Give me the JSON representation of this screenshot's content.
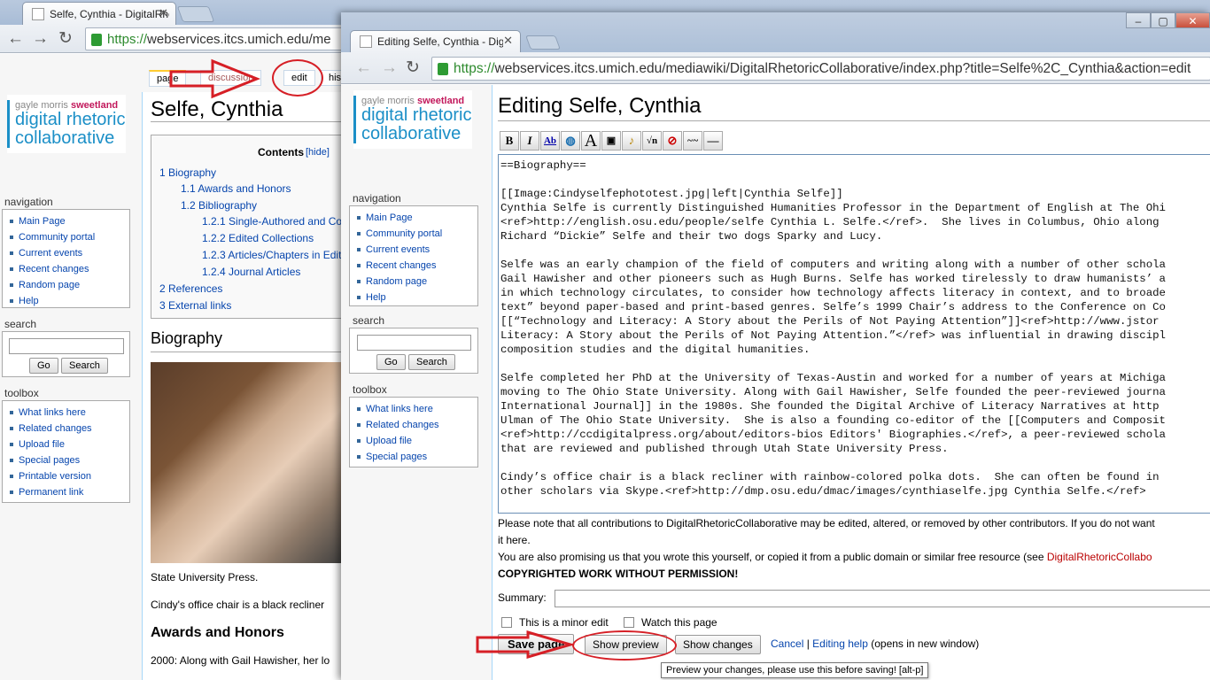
{
  "back": {
    "tab_title": "Selfe, Cynthia - DigitalRhe",
    "url_https": "https://",
    "url_rest": "webservices.itcs.umich.edu/me",
    "tabs": {
      "page": "page",
      "discussion": "discussion",
      "edit": "edit",
      "history": "his"
    },
    "page_title": "Selfe, Cynthia",
    "toc": {
      "title": "Contents",
      "hide": "[hide]",
      "items": [
        "1 Biography",
        "1.1 Awards and Honors",
        "1.2 Bibliography",
        "1.2.1 Single-Authored and Co",
        "1.2.2 Edited Collections",
        "1.2.3 Articles/Chapters in Edit",
        "1.2.4 Journal Articles",
        "2 References",
        "3 External links"
      ]
    },
    "biography_heading": "Biography",
    "para1": "State University Press.",
    "para2": "Cindy's office chair is a black recliner",
    "awards_heading": "Awards and Honors",
    "para3": "2000: Along with Gail Hawisher, her lo",
    "navigation": [
      "Main Page",
      "Community portal",
      "Current events",
      "Recent changes",
      "Random page",
      "Help"
    ],
    "toolbox": [
      "What links here",
      "Related changes",
      "Upload file",
      "Special pages",
      "Printable version",
      "Permanent link"
    ]
  },
  "logo": {
    "line1a": "gayle morris ",
    "line1b": "sweetland",
    "line2": "digital rhetoric",
    "line3": "collaborative"
  },
  "sidebar": {
    "navigation_heading": "navigation",
    "search_heading": "search",
    "go_label": "Go",
    "search_label": "Search",
    "toolbox_heading": "toolbox"
  },
  "front": {
    "tab_title": "Editing Selfe, Cynthia - Dig",
    "url_https": "https://",
    "url_rest": "webservices.itcs.umich.edu/mediawiki/DigitalRhetoricCollaborative/index.php?title=Selfe%2C_Cynthia&action=edit",
    "navigation": [
      "Main Page",
      "Community portal",
      "Current events",
      "Recent changes",
      "Random page",
      "Help"
    ],
    "toolbox": [
      "What links here",
      "Related changes",
      "Upload file",
      "Special pages"
    ],
    "page_title": "Editing Selfe, Cynthia",
    "editor_text": "==Biography==\n\n[[Image:Cindyselfephototest.jpg|left|Cynthia Selfe]]\nCynthia Selfe is currently Distinguished Humanities Professor in the Department of English at The Ohi\n<ref>http://english.osu.edu/people/selfe Cynthia L. Selfe.</ref>.  She lives in Columbus, Ohio along\nRichard “Dickie” Selfe and their two dogs Sparky and Lucy.\n\nSelfe was an early champion of the field of computers and writing along with a number of other schola\nGail Hawisher and other pioneers such as Hugh Burns. Selfe has worked tirelessly to draw humanists’ a\nin which technology circulates, to consider how technology affects literacy in context, and to broade\ntext” beyond paper-based and print-based genres. Selfe’s 1999 Chair’s address to the Conference on Co\n[[“Technology and Literacy: A Story about the Perils of Not Paying Attention”]]<ref>http://www.jstor\nLiteracy: A Story about the Perils of Not Paying Attention.”</ref> was influential in drawing discipl\ncomposition studies and the digital humanities.\n\nSelfe completed her PhD at the University of Texas-Austin and worked for a number of years at Michiga\nmoving to The Ohio State University. Along with Gail Hawisher, Selfe founded the peer-reviewed journa\nInternational Journal]] in the 1980s. She founded the Digital Archive of Literacy Narratives at http\nUlman of The Ohio State University.  She is also a founding co-editor of the [[Computers and Composit\n<ref>http://ccdigitalpress.org/about/editors-bios Editors' Biographies.</ref>, a peer-reviewed schola\nthat are reviewed and published through Utah State University Press.\n\nCindy’s office chair is a black recliner with rainbow-colored polka dots.  She can often be found in\nother scholars via Skype.<ref>http://dmp.osu.edu/dmac/images/cynthiaselfe.jpg Cynthia Selfe.</ref>",
    "notice1": "Please note that all contributions to DigitalRhetoricCollaborative may be edited, altered, or removed by other contributors. If you do not want",
    "notice2": "it here.",
    "notice3a": "You are also promising us that you wrote this yourself, or copied it from a public domain or similar free resource (see ",
    "notice3b": "DigitalRhetoricCollabo",
    "notice4": "COPYRIGHTED WORK WITHOUT PERMISSION!",
    "summary_label": "Summary:",
    "minor_edit": "This is a minor edit",
    "watch_page": "Watch this page",
    "save_label": "Save page",
    "preview_label": "Show preview",
    "changes_label": "Show changes",
    "cancel_label": "Cancel",
    "sep": "|",
    "help_label": "Editing help",
    "help_suffix": "(opens in new window)",
    "tooltip": "Preview your changes, please use this before saving! [alt-p]"
  },
  "annotation_color": "#d61f26"
}
